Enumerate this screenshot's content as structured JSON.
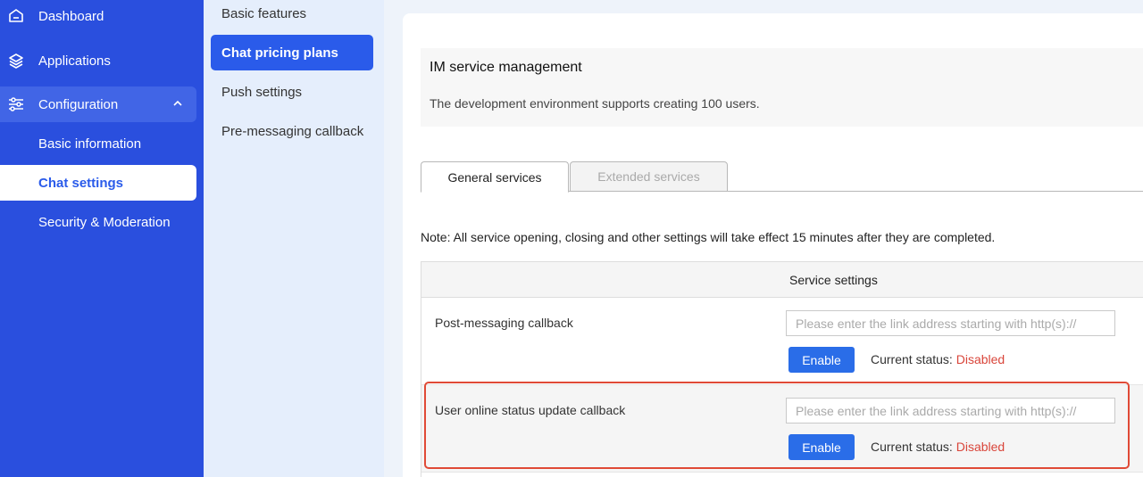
{
  "sidebar": {
    "items": [
      {
        "label": "Dashboard",
        "icon": "home-icon"
      },
      {
        "label": "Applications",
        "icon": "layers-icon"
      },
      {
        "label": "Configuration",
        "icon": "sliders-icon"
      }
    ],
    "sub_items": [
      {
        "label": "Basic information"
      },
      {
        "label": "Chat settings"
      },
      {
        "label": "Security & Moderation"
      }
    ]
  },
  "subnav": {
    "items": [
      {
        "label": "Basic features"
      },
      {
        "label": "Chat pricing plans"
      },
      {
        "label": "Push settings"
      },
      {
        "label": "Pre-messaging callback"
      }
    ]
  },
  "info": {
    "title": "IM service management",
    "description": "The development environment supports creating 100 users."
  },
  "tabs": {
    "general": "General services",
    "extended": "Extended services"
  },
  "note": "Note: All service opening, closing and other settings will take effect 15 minutes after they are completed.",
  "table": {
    "header": "Service settings",
    "rows": [
      {
        "label": "Post-messaging callback",
        "placeholder": "Please enter the link address starting with http(s)://",
        "button": "Enable",
        "status_label": "Current status:",
        "status_value": "Disabled"
      },
      {
        "label": "User online status update callback",
        "placeholder": "Please enter the link address starting with http(s)://",
        "button": "Enable",
        "status_label": "Current status:",
        "status_value": "Disabled"
      }
    ]
  },
  "colors": {
    "sidebar_bg": "#2a4fde",
    "accent": "#2a5bea",
    "disabled_status": "#d9453a",
    "highlight_border": "#e04a36"
  }
}
